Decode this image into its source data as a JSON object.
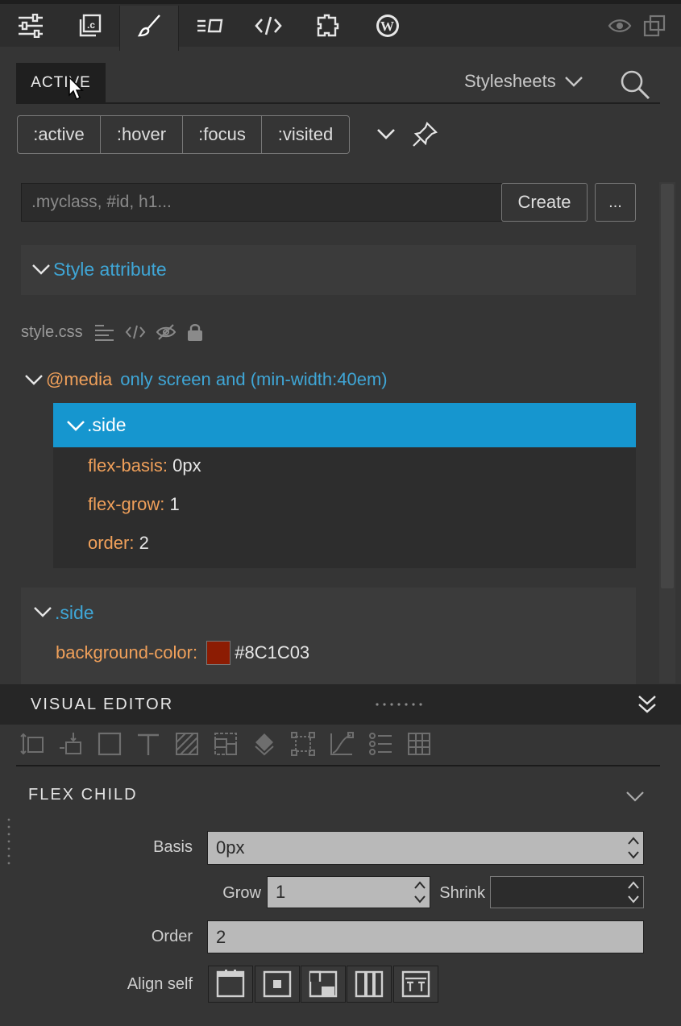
{
  "toolbar": {
    "icons": [
      "sliders-icon",
      "copy-class-icon",
      "brush-icon",
      "list-box-icon",
      "code-icon",
      "puzzle-icon",
      "wordpress-icon",
      "eye-icon",
      "windows-icon"
    ]
  },
  "tabs": {
    "active_label": "ACTIVE",
    "stylesheets_label": "Stylesheets"
  },
  "pseudo": [
    ":active",
    ":hover",
    ":focus",
    ":visited"
  ],
  "selector": {
    "placeholder": ".myclass, #id, h1...",
    "create_label": "Create",
    "more_label": "..."
  },
  "style_attribute": "Style attribute",
  "stylesheet": {
    "file": "style.css"
  },
  "media": {
    "keyword": "@media",
    "query": "only screen and (min-width:40em)"
  },
  "rule1": {
    "selector": ".side",
    "props": [
      {
        "name": "flex-basis",
        "value": "0px"
      },
      {
        "name": "flex-grow",
        "value": "1"
      },
      {
        "name": "order",
        "value": "2"
      }
    ]
  },
  "rule2": {
    "selector": ".side",
    "bg_prop": "background-color",
    "bg_value": "#8C1C03",
    "bg_swatch": "#8C1C03"
  },
  "visual_editor": {
    "title": "VISUAL EDITOR",
    "section": "FLEX CHILD",
    "basis_label": "Basis",
    "basis_value": "0px",
    "grow_label": "Grow",
    "grow_value": "1",
    "shrink_label": "Shrink",
    "shrink_value": "",
    "order_label": "Order",
    "order_value": "2",
    "align_label": "Align self"
  },
  "colors": {
    "accent_blue": "#1696CF",
    "link_blue": "#3FA6D6",
    "prop_orange": "#F0A05A"
  }
}
